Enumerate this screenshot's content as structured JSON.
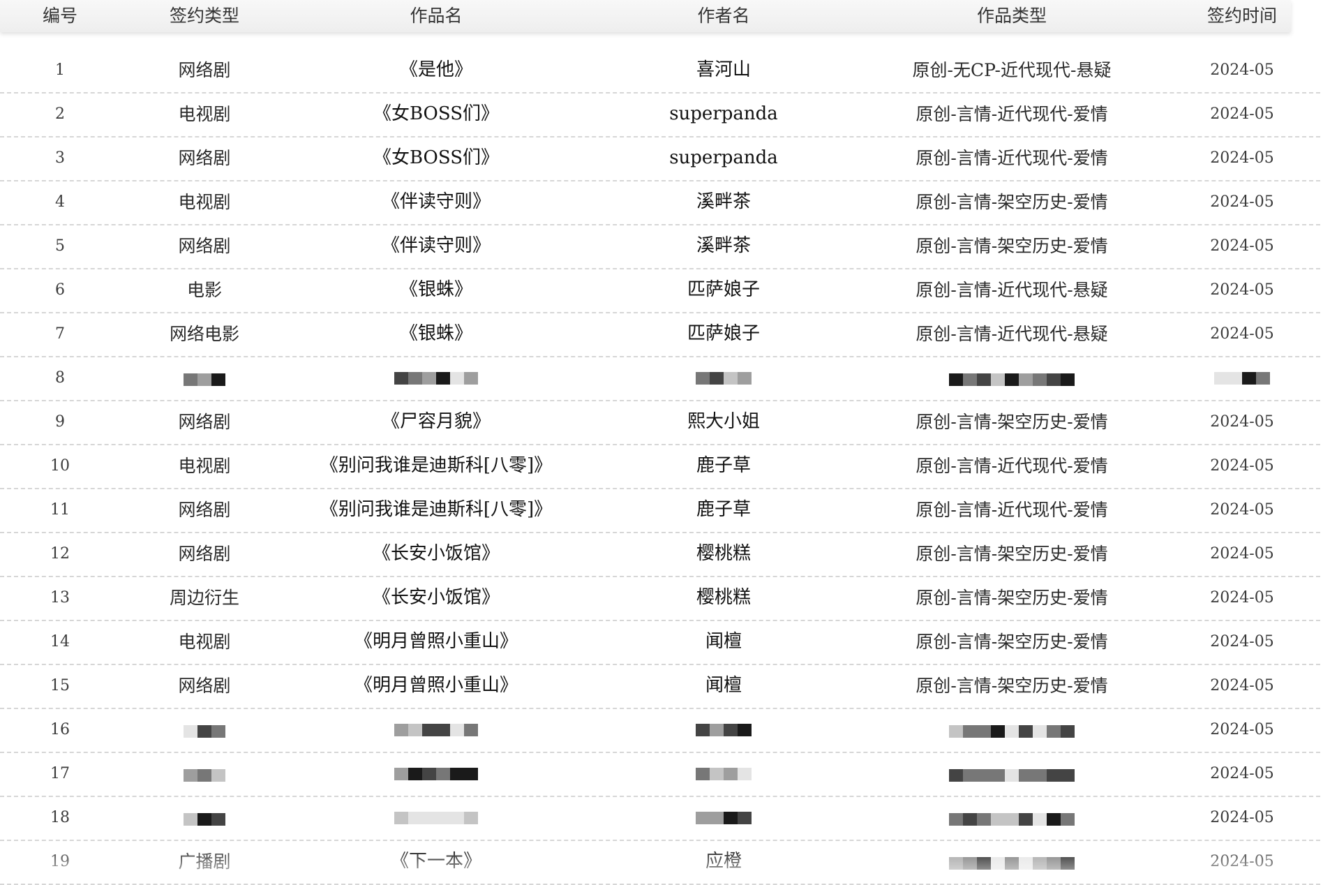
{
  "header": {
    "columns": [
      "编号",
      "签约类型",
      "作品名",
      "作者名",
      "作品类型",
      "签约时间"
    ]
  },
  "rows": [
    {
      "id": "1",
      "sign_type": "网络剧",
      "title": "《是他》",
      "author": "喜河山",
      "genre": "原创-无CP-近代现代-悬疑",
      "date": "2024-05"
    },
    {
      "id": "2",
      "sign_type": "电视剧",
      "title": "《女BOSS们》",
      "author": "superpanda",
      "genre": "原创-言情-近代现代-爱情",
      "date": "2024-05"
    },
    {
      "id": "3",
      "sign_type": "网络剧",
      "title": "《女BOSS们》",
      "author": "superpanda",
      "genre": "原创-言情-近代现代-爱情",
      "date": "2024-05"
    },
    {
      "id": "4",
      "sign_type": "电视剧",
      "title": "《伴读守则》",
      "author": "溪畔茶",
      "genre": "原创-言情-架空历史-爱情",
      "date": "2024-05"
    },
    {
      "id": "5",
      "sign_type": "网络剧",
      "title": "《伴读守则》",
      "author": "溪畔茶",
      "genre": "原创-言情-架空历史-爱情",
      "date": "2024-05"
    },
    {
      "id": "6",
      "sign_type": "电影",
      "title": "《银蛛》",
      "author": "匹萨娘子",
      "genre": "原创-言情-近代现代-悬疑",
      "date": "2024-05"
    },
    {
      "id": "7",
      "sign_type": "网络电影",
      "title": "《银蛛》",
      "author": "匹萨娘子",
      "genre": "原创-言情-近代现代-悬疑",
      "date": "2024-05"
    },
    {
      "id": "8",
      "sign_type": "",
      "title": "",
      "author": "",
      "genre": "",
      "date": ""
    },
    {
      "id": "9",
      "sign_type": "网络剧",
      "title": "《尸容月貌》",
      "author": "熙大小姐",
      "genre": "原创-言情-架空历史-爱情",
      "date": "2024-05"
    },
    {
      "id": "10",
      "sign_type": "电视剧",
      "title": "《别问我谁是迪斯科[八零]》",
      "author": "鹿子草",
      "genre": "原创-言情-近代现代-爱情",
      "date": "2024-05"
    },
    {
      "id": "11",
      "sign_type": "网络剧",
      "title": "《别问我谁是迪斯科[八零]》",
      "author": "鹿子草",
      "genre": "原创-言情-近代现代-爱情",
      "date": "2024-05"
    },
    {
      "id": "12",
      "sign_type": "网络剧",
      "title": "《长安小饭馆》",
      "author": "樱桃糕",
      "genre": "原创-言情-架空历史-爱情",
      "date": "2024-05"
    },
    {
      "id": "13",
      "sign_type": "周边衍生",
      "title": "《长安小饭馆》",
      "author": "樱桃糕",
      "genre": "原创-言情-架空历史-爱情",
      "date": "2024-05"
    },
    {
      "id": "14",
      "sign_type": "电视剧",
      "title": "《明月曾照小重山》",
      "author": "闻檀",
      "genre": "原创-言情-架空历史-爱情",
      "date": "2024-05"
    },
    {
      "id": "15",
      "sign_type": "网络剧",
      "title": "《明月曾照小重山》",
      "author": "闻檀",
      "genre": "原创-言情-架空历史-爱情",
      "date": "2024-05"
    },
    {
      "id": "16",
      "sign_type": "",
      "title": "",
      "author": "",
      "genre": "",
      "date": "2024-05"
    },
    {
      "id": "17",
      "sign_type": "",
      "title": "",
      "author": "",
      "genre": "",
      "date": "2024-05"
    },
    {
      "id": "18",
      "sign_type": "",
      "title": "",
      "author": "",
      "genre": "",
      "date": "2024-05"
    },
    {
      "id": "19",
      "sign_type": "广播剧",
      "title": "《下一本》",
      "author": "应橙",
      "genre": "",
      "date": "2024-05"
    }
  ],
  "mosaic_colors": [
    "#1a1a1a",
    "#444444",
    "#777777",
    "#9e9e9e",
    "#c4c4c4",
    "#e4e4e4"
  ]
}
